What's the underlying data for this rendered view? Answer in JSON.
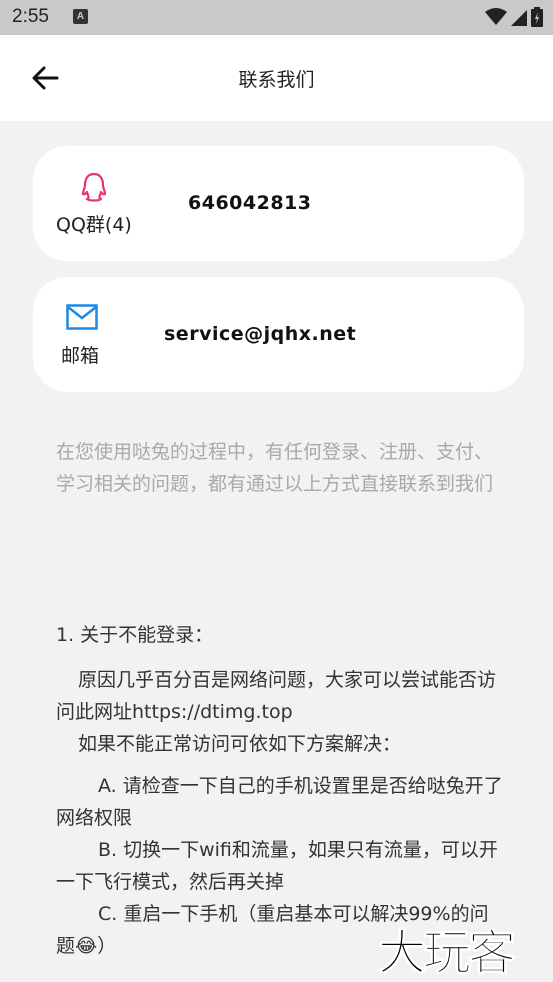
{
  "status_bar": {
    "time": "2:55",
    "notification_icon": "A"
  },
  "header": {
    "title": "联系我们",
    "back_icon": "arrow-left-icon"
  },
  "contacts": [
    {
      "icon": "qq-icon",
      "label": "QQ群(4)",
      "value": "646042813",
      "icon_color": "#e8336d"
    },
    {
      "icon": "mail-icon",
      "label": "邮箱",
      "value": "service@jqhx.net",
      "icon_color": "#1e88e5"
    }
  ],
  "intro_text": "在您使用哒兔的过程中，有任何登录、注册、支付、学习相关的问题，都有通过以上方式直接联系到我们",
  "faq": {
    "question": "1. 关于不能登录：",
    "answer_line1": "原因几乎百分百是网络问题，大家可以尝试能否访问此网址https://dtimg.top",
    "answer_line2": "如果不能正常访问可依如下方案解决：",
    "solution_a": "A. 请检查一下自己的手机设置里是否给哒兔开了网络权限",
    "solution_b": "B. 切换一下wifi和流量，如果只有流量，可以开一下飞行模式，然后再关掉",
    "solution_c": "C. 重启一下手机（重启基本可以解决99%的问题😂）"
  },
  "watermark": "大玩客",
  "colors": {
    "background": "#f2f2f2",
    "card": "#ffffff",
    "muted_text": "#a9a9a9"
  }
}
